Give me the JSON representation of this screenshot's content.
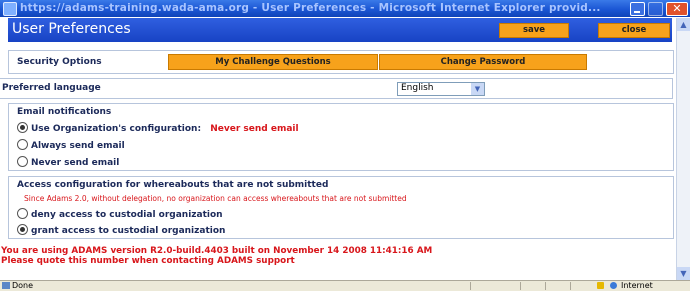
{
  "window": {
    "title": "https://adams-training.wada-ama.org - User Preferences - Microsoft Internet Explorer provid...",
    "close_glyph": "✕"
  },
  "header": {
    "title": "User Preferences",
    "save_label": "save",
    "close_label": "close"
  },
  "security": {
    "label": "Security Options",
    "challenge_button": "My Challenge Questions",
    "password_button": "Change Password"
  },
  "language": {
    "label": "Preferred language",
    "selected": "English"
  },
  "email": {
    "heading": "Email notifications",
    "options": [
      {
        "label": "Use Organization's configuration:",
        "note": "Never send email",
        "checked": true
      },
      {
        "label": "Always send email",
        "checked": false
      },
      {
        "label": "Never send email",
        "checked": false
      }
    ]
  },
  "access": {
    "heading": "Access configuration for whereabouts that are not submitted",
    "notice": "Since Adams 2.0, without delegation, no organization can access whereabouts that are not submitted",
    "options": [
      {
        "label": "deny access to custodial organization",
        "checked": false
      },
      {
        "label": "grant access to custodial organization",
        "checked": true
      }
    ]
  },
  "version": {
    "line1": "You are using ADAMS version R2.0-build.4403 built on November 14 2008 11:41:16 AM",
    "line2": "Please quote this number when contacting ADAMS support"
  },
  "statusbar": {
    "status": "Done",
    "zone": "Internet"
  },
  "colors": {
    "accent_blue": "#1b56d4",
    "button_orange": "#f7a21b",
    "warning_red": "#d8161b"
  }
}
